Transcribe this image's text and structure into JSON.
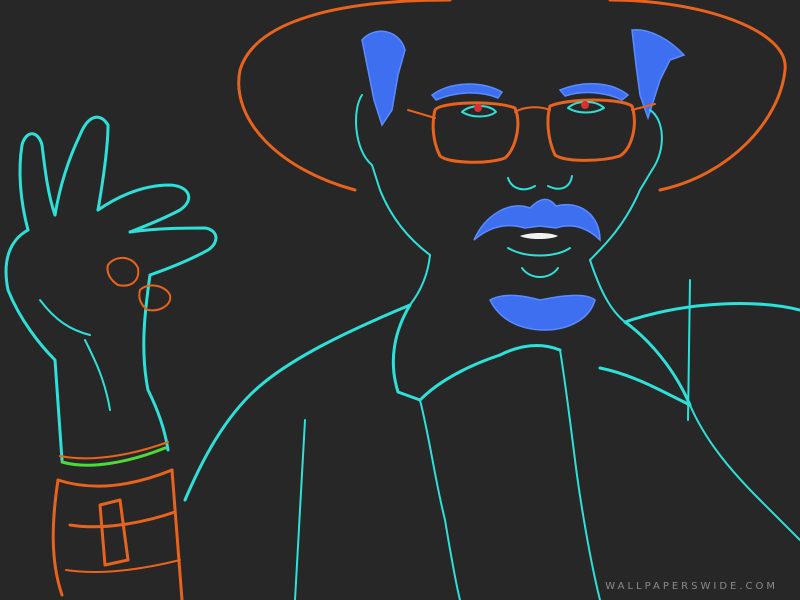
{
  "image": {
    "background_color": "#272727",
    "line_colors": {
      "outline": "#2fe0d8",
      "hat_glasses_wristband": "#e8631e",
      "hair_beard": "#3d6ff0",
      "bracelet": "#4fd83a",
      "eyes": "#d83030"
    }
  },
  "watermark": {
    "text": "WALLPAPERSWIDE.COM"
  }
}
